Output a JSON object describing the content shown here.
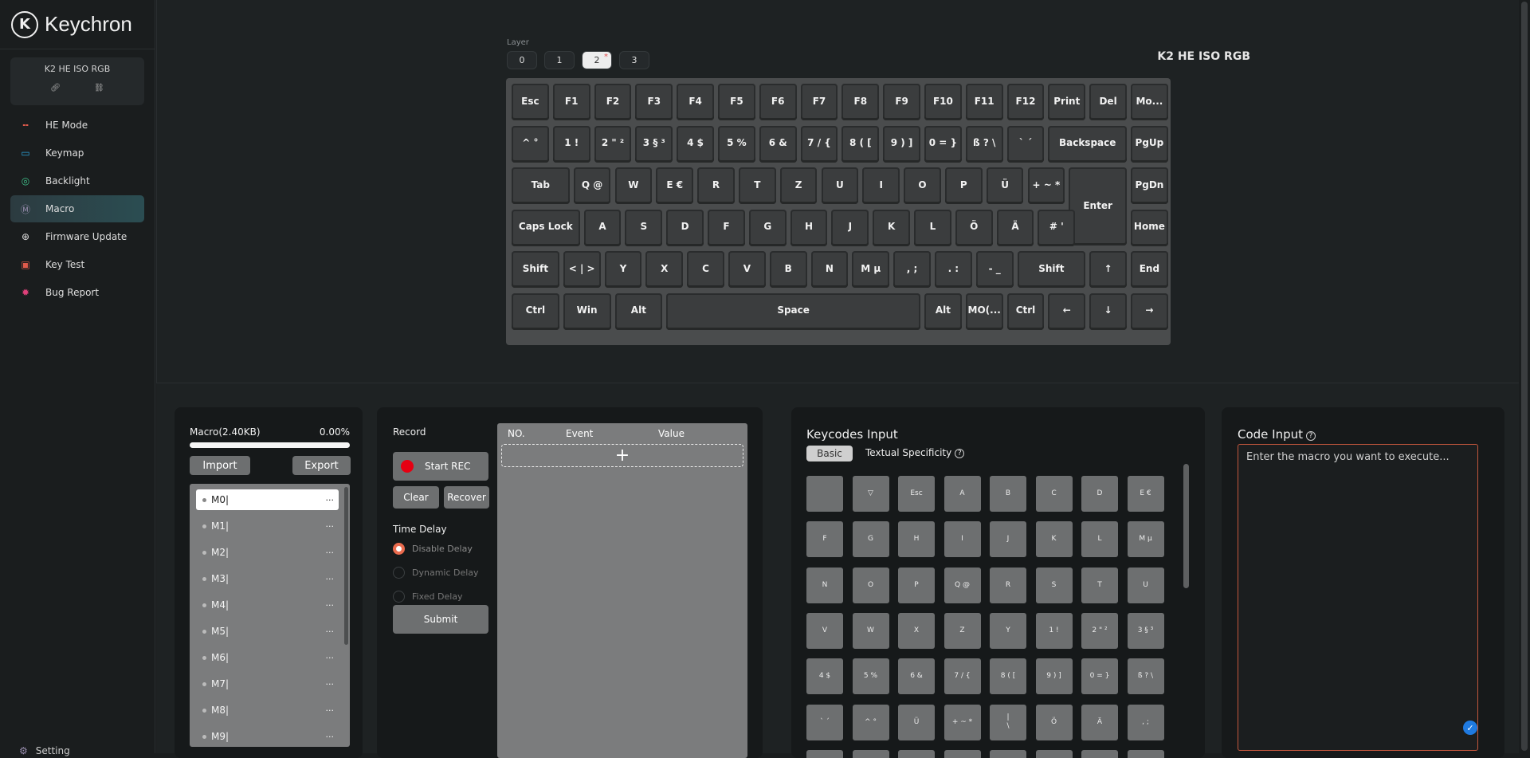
{
  "brand": {
    "name": "Keychron",
    "logo_icon": "keychron-k-logo"
  },
  "device": {
    "name": "K2 HE ISO RGB"
  },
  "nav": [
    {
      "label": "HE Mode",
      "icon": "he-mode-icon",
      "glyph": "╍",
      "color": "#e05a4b",
      "active": false
    },
    {
      "label": "Keymap",
      "icon": "keymap-icon",
      "glyph": "▭",
      "color": "#2a9fd6",
      "active": false
    },
    {
      "label": "Backlight",
      "icon": "backlight-icon",
      "glyph": "◎",
      "color": "#3fc08a",
      "active": false
    },
    {
      "label": "Macro",
      "icon": "macro-icon",
      "glyph": "Ⓜ",
      "color": "#9a8fb0",
      "active": true
    },
    {
      "label": "Firmware Update",
      "icon": "firmware-update-icon",
      "glyph": "⊕",
      "color": "#dddddd",
      "active": false
    },
    {
      "label": "Key Test",
      "icon": "key-test-icon",
      "glyph": "▣",
      "color": "#e05a4b",
      "active": false
    },
    {
      "label": "Bug Report",
      "icon": "bug-report-icon",
      "glyph": "✹",
      "color": "#e0407a",
      "active": false
    }
  ],
  "layers": {
    "label": "Layer",
    "items": [
      "0",
      "1",
      "2",
      "3"
    ],
    "active": "2"
  },
  "keyboard_title": "K2 HE ISO RGB",
  "keyboard_rows": [
    [
      "Esc",
      "F1",
      "F2",
      "F3",
      "F4",
      "F5",
      "F6",
      "F7",
      "F8",
      "F9",
      "F10",
      "F11",
      "F12",
      "Print",
      "Del",
      "Mo..."
    ],
    [
      "^ °",
      "1 !",
      "2 \" ²",
      "3 § ³",
      "4 $",
      "5 %",
      "6 &",
      "7 / {",
      "8 ( [",
      "9 ) ]",
      "0 = }",
      "ß ? \\",
      "` ´",
      "Backspace",
      "PgUp"
    ],
    [
      "Tab",
      "Q @",
      "W",
      "E €",
      "R",
      "T",
      "Z",
      "U",
      "I",
      "O",
      "P",
      "Ü",
      "+ ~ *",
      "Enter",
      "PgDn"
    ],
    [
      "Caps Lock",
      "A",
      "S",
      "D",
      "F",
      "G",
      "H",
      "J",
      "K",
      "L",
      "Ö",
      "Ä",
      "# '",
      "Home"
    ],
    [
      "Shift",
      "< | >",
      "Y",
      "X",
      "C",
      "V",
      "B",
      "N",
      "M µ",
      ", ;",
      ". :",
      "- _",
      "Shift",
      "↑",
      "End"
    ],
    [
      "Ctrl",
      "Win",
      "Alt",
      "Space",
      "Alt",
      "MO(...",
      "Ctrl",
      "←",
      "↓",
      "→"
    ]
  ],
  "macro": {
    "title": "Macro(2.40KB)",
    "usage": "0.00%",
    "usage_fraction": 0.0,
    "import_label": "Import",
    "export_label": "Export",
    "items": [
      "M0",
      "M1",
      "M2",
      "M3",
      "M4",
      "M5",
      "M6",
      "M7",
      "M8",
      "M9"
    ],
    "active": "M0",
    "more_label": "···"
  },
  "record": {
    "title": "Record",
    "start_label": "Start REC",
    "clear_label": "Clear",
    "recover_label": "Recover",
    "delay_title": "Time Delay",
    "delay_options": [
      "Disable Delay",
      "Dynamic Delay",
      "Fixed Delay"
    ],
    "delay_selected": "Disable Delay",
    "submit_label": "Submit",
    "columns": [
      "NO.",
      "Event",
      "Value"
    ],
    "add_label": "+"
  },
  "keycodes": {
    "title": "Keycodes Input",
    "tab_basic": "Basic",
    "tab_textual": "Textual Specificity",
    "help_glyph": "?",
    "grid": [
      [
        "",
        "▽",
        "Esc",
        "A",
        "B",
        "C",
        "D",
        "E €"
      ],
      [
        "F",
        "G",
        "H",
        "I",
        "J",
        "K",
        "L",
        "M µ"
      ],
      [
        "N",
        "O",
        "P",
        "Q @",
        "R",
        "S",
        "T",
        "U"
      ],
      [
        "V",
        "W",
        "X",
        "Z",
        "Y",
        "1 !",
        "2 \" ²",
        "3 § ³"
      ],
      [
        "4 $",
        "5 %",
        "6 &",
        "7 / {",
        "8 ( [",
        "9 ) ]",
        "0 = }",
        "ß ? \\"
      ],
      [
        "` ´",
        "^ °",
        "Ü",
        "+ ~ *",
        "|\n\\",
        "Ö",
        "Ä",
        ", ;"
      ],
      [
        "",
        "",
        "",
        "",
        "",
        "",
        "",
        ""
      ]
    ]
  },
  "code_input": {
    "title": "Code Input",
    "help_glyph": "?",
    "placeholder": "Enter the macro you want to execute...",
    "confirm_glyph": "✓"
  },
  "settings_label": "Setting"
}
